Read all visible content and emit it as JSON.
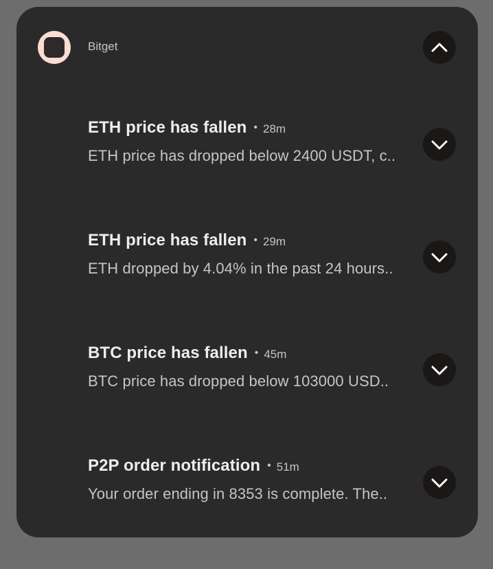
{
  "app": {
    "name": "Bitget"
  },
  "notifications": [
    {
      "title": "ETH price has fallen",
      "time": "28m",
      "body": "ETH price has dropped below 2400 USDT, c.."
    },
    {
      "title": "ETH price has fallen",
      "time": "29m",
      "body": "ETH dropped by 4.04% in the past 24 hours.."
    },
    {
      "title": "BTC price has fallen",
      "time": "45m",
      "body": "BTC price has dropped below 103000 USD.."
    },
    {
      "title": "P2P order notification",
      "time": "51m",
      "body": "Your order ending in 8353 is complete. The.."
    }
  ],
  "icons": {
    "collapse": "chevron-up-icon",
    "expand": "chevron-down-icon",
    "app": "bitget-app-icon"
  },
  "colors": {
    "panel_background": "#2a2a2a",
    "app_icon": "#fbdcd3",
    "button_background": "#1b1716"
  }
}
